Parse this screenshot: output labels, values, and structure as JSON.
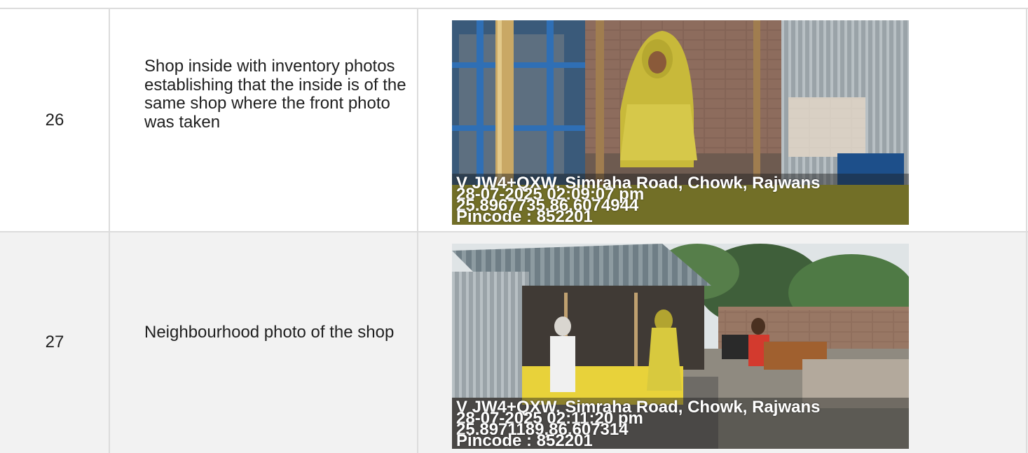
{
  "rows": [
    {
      "number": "26",
      "description": "Shop inside with inventory photos establishing that the inside is of the same shop where the front photo was taken",
      "photo": {
        "subject": "woman in yellow standing inside shop with egg trays",
        "stamp_lines": [
          "V JW4+QXW, Simraha Road, Chowk, Rajwans",
          "28-07-2025 02:09:07 pm",
          "25.8967735,86.6074944",
          "Pincode : 852201"
        ]
      }
    },
    {
      "number": "27",
      "description": "Neighbourhood photo of the shop",
      "photo": {
        "subject": "tin roof shop exterior with people and motorbike",
        "stamp_lines": [
          "V JW4+QXW, Simraha Road, Chowk, Rajwans",
          "28-07-2025 02:11:20 pm",
          "25.8971189,86.607314",
          "Pincode : 852201"
        ]
      }
    }
  ],
  "colors": {
    "border": "#dcdcdc",
    "row_alt": "#f2f2f2",
    "text": "#1f1f1f"
  }
}
